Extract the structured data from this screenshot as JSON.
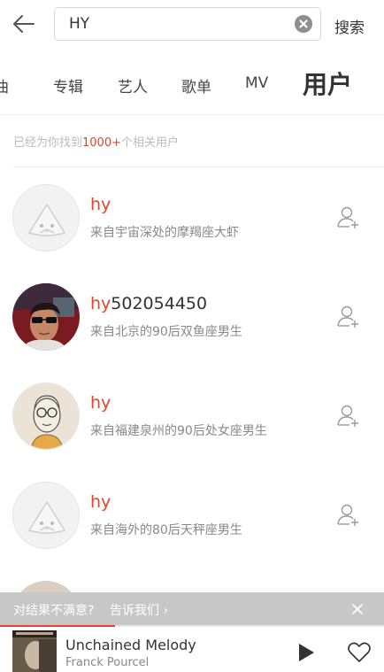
{
  "header": {
    "back_icon": "arrow-left-icon",
    "search_value": "HY",
    "clear_icon": "close-circle-icon",
    "search_label": "搜索"
  },
  "tabs": [
    {
      "label": "曲"
    },
    {
      "label": "专辑"
    },
    {
      "label": "艺人"
    },
    {
      "label": "歌单"
    },
    {
      "label": "MV"
    },
    {
      "label": "用户",
      "active": true
    }
  ],
  "results": {
    "prefix": "已经为你找到",
    "count": "1000+",
    "suffix": "个相关用户"
  },
  "users": [
    {
      "name_match": "hy",
      "name_rest": "",
      "desc": "来自宇宙深处的摩羯座大虾",
      "avatar": "default-avatar"
    },
    {
      "name_match": "hy",
      "name_rest": "502054450",
      "desc": "来自北京的90后双鱼座男生",
      "avatar": "photo-avatar"
    },
    {
      "name_match": "hy",
      "name_rest": "",
      "desc": "来自福建泉州的90后处女座男生",
      "avatar": "drawing-avatar"
    },
    {
      "name_match": "hy",
      "name_rest": "",
      "desc": "来自海外的80后天秤座男生",
      "avatar": "default-avatar"
    }
  ],
  "feedback": {
    "text": "对结果不满意?",
    "link": "告诉我们 ›"
  },
  "player": {
    "title": "Unchained Melody",
    "artist": "Franck Pourcel",
    "progress": 0.3
  },
  "colors": {
    "accent": "#e8412c",
    "muted": "#888888"
  }
}
